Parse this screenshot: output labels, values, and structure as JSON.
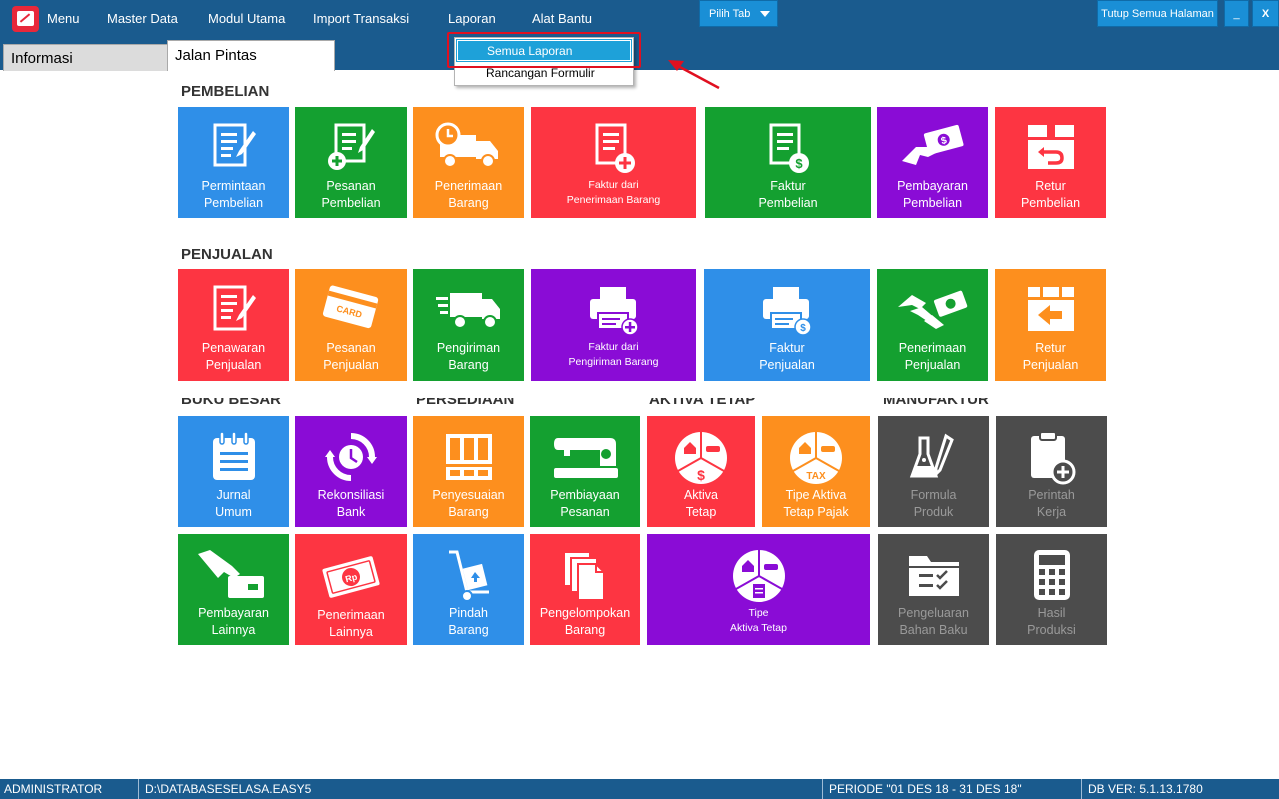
{
  "menubar": {
    "menu_label": "Menu",
    "items": [
      "Master Data",
      "Modul Utama",
      "Import Transaksi",
      "Laporan",
      "Alat Bantu"
    ],
    "pilih_tab": "Pilih Tab",
    "tutup_semua": "Tutup Semua Halaman",
    "minimize": "_",
    "close": "X"
  },
  "tabs": {
    "informasi": "Informasi",
    "jalan_pintas": "Jalan Pintas"
  },
  "dropdown": {
    "items": [
      "Semua Laporan",
      "Rancangan Formulir"
    ]
  },
  "sections": {
    "pembelian": "PEMBELIAN",
    "penjualan": "PENJUALAN",
    "buku_besar": "BUKU BESAR",
    "persediaan": "PERSEDIAAN",
    "aktiva_tetap": "AKTIVA TETAP",
    "manufaktur": "MANUFAKTUR"
  },
  "tiles": {
    "permintaan_pembelian": "Permintaan\nPembelian",
    "pesanan_pembelian": "Pesanan\nPembelian",
    "penerimaan_barang": "Penerimaan\nBarang",
    "faktur_penerimaan": "Faktur dari\nPenerimaan Barang",
    "faktur_pembelian": "Faktur\nPembelian",
    "pembayaran_pembelian": "Pembayaran\nPembelian",
    "retur_pembelian": "Retur\nPembelian",
    "penawaran_penjualan": "Penawaran\nPenjualan",
    "pesanan_penjualan": "Pesanan\nPenjualan",
    "pengiriman_barang": "Pengiriman\nBarang",
    "faktur_pengiriman": "Faktur dari\nPengiriman Barang",
    "faktur_penjualan": "Faktur\nPenjualan",
    "penerimaan_penjualan": "Penerimaan\nPenjualan",
    "retur_penjualan": "Retur\nPenjualan",
    "jurnal_umum": "Jurnal\nUmum",
    "rekonsiliasi_bank": "Rekonsiliasi\nBank",
    "penyesuaian_barang": "Penyesuaian\nBarang",
    "pembiayaan_pesanan": "Pembiayaan\nPesanan",
    "aktiva_tetap": "Aktiva\nTetap",
    "tipe_aktiva_pajak": "Tipe Aktiva\nTetap Pajak",
    "formula_produk": "Formula\nProduk",
    "perintah_kerja": "Perintah\nKerja",
    "pembayaran_lainnya": "Pembayaran\nLainnya",
    "penerimaan_lainnya": "Penerimaan\nLainnya",
    "pindah_barang": "Pindah\nBarang",
    "pengelompokan_barang": "Pengelompokan\nBarang",
    "tipe_aktiva_tetap": "Tipe\nAktiva Tetap",
    "pengeluaran_bahan_baku": "Pengeluaran\nBahan Baku",
    "hasil_produksi": "Hasil\nProduksi"
  },
  "icon_badges": {
    "card": "CARD",
    "tax": "TAX",
    "rp": "Rp"
  },
  "statusbar": {
    "user": "ADMINISTRATOR",
    "database": "D:\\DATABASESELASA.EASY5",
    "periode": "PERIODE \"01 DES 18 - 31 DES 18\"",
    "db_ver": "DB VER: 5.1.13.1780"
  },
  "colors": {
    "topbar": "#1a5b8e",
    "blue": "#2f8fe8",
    "green": "#14a030",
    "orange": "#fd8f1e",
    "red": "#fd3542",
    "purple": "#8a0cd6",
    "gray": "#4c4c4c",
    "highlight_red": "#e01020"
  }
}
